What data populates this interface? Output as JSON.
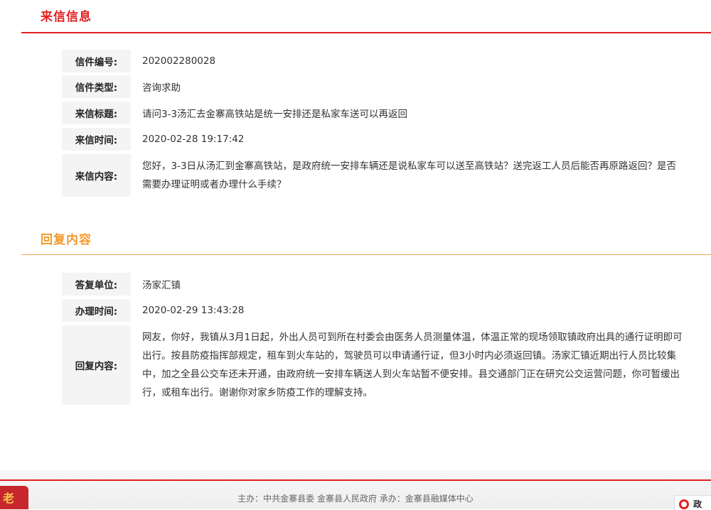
{
  "letter_section": {
    "title": "来信信息",
    "fields": [
      {
        "label": "信件编号:",
        "value": "202002280028"
      },
      {
        "label": "信件类型:",
        "value": "咨询求助"
      },
      {
        "label": "来信标题:",
        "value": "请问3-3汤汇去金寨高铁站是统一安排还是私家车送可以再返回"
      },
      {
        "label": "来信时间:",
        "value": "2020-02-28 19:17:42"
      },
      {
        "label": "来信内容:",
        "value": "您好，3-3日从汤汇到金寨高铁站，是政府统一安排车辆还是说私家车可以送至高铁站？送完返工人员后能否再原路返回？是否需要办理证明或者办理什么手续？"
      }
    ]
  },
  "reply_section": {
    "title": "回复内容",
    "fields": [
      {
        "label": "答复单位:",
        "value": "汤家汇镇"
      },
      {
        "label": "办理时间:",
        "value": "2020-02-29 13:43:28"
      },
      {
        "label": "回复内容:",
        "value": "网友，你好，我镇从3月1日起，外出人员可到所在村委会由医务人员测量体温，体温正常的现场领取镇政府出具的通行证明即可出行。按县防疫指挥部规定，租车到火车站的，驾驶员可以申请通行证，但3小时内必须返回镇。汤家汇镇近期出行人员比较集中，加之全县公交车还未开通，由政府统一安排车辆送人到火车站暂不便安排。县交通部门正在研究公交运营问题，你可暂缓出行，或租车出行。谢谢你对家乡防疫工作的理解支持。"
      }
    ]
  },
  "footer": {
    "text": "主办：中共金寨县委  金寨县人民政府  承办：金寨县融媒体中心",
    "logo_glyph": "老",
    "badge_text": "政"
  },
  "colors": {
    "primary_red": "#e02020",
    "orange": "#f29a2e"
  }
}
